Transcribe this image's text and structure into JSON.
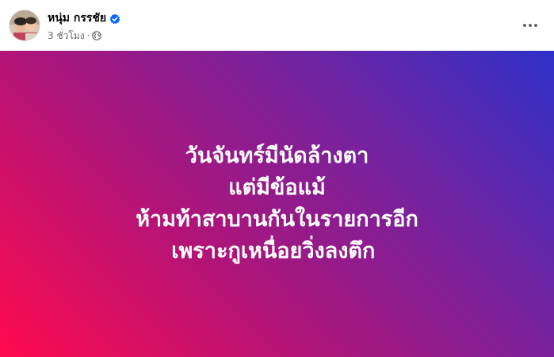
{
  "author": {
    "name": "หนุ่ม กรรชัย",
    "verified": true,
    "avatar": "profile-photo"
  },
  "meta": {
    "timestamp": "3 ชั่วโมง",
    "separator": "·",
    "audience_icon": "globe-icon"
  },
  "actions": {
    "more_icon": "more-horizontal-icon"
  },
  "post": {
    "background_gradient": [
      "#ff0a4e",
      "#ad157a",
      "#7024a2",
      "#2e30c8"
    ],
    "text_color": "#ffffff",
    "lines": [
      "วันจันทร์มีนัดล้างตา",
      "แต่มีข้อแม้",
      "ห้ามท้าสาบานกันในรายการอีก",
      "เพราะกูเหนื่อยวิ่งลงตึก ￼"
    ]
  },
  "colors": {
    "verified_badge": "#0866ff",
    "secondary_text": "#65676b",
    "primary_text": "#050505"
  }
}
